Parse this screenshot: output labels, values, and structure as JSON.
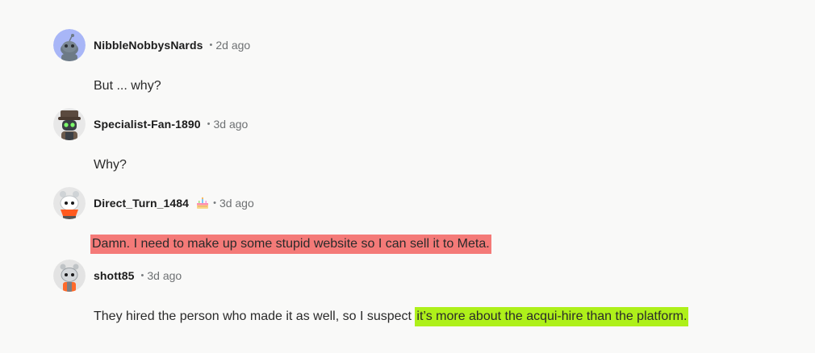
{
  "comments": [
    {
      "username": "NibbleNobbysNards",
      "time": "2d ago",
      "separator": "•",
      "body": "But ... why?",
      "avatar": "default-snoo-blue-avatar"
    },
    {
      "username": "Specialist-Fan-1890",
      "time": "3d ago",
      "separator": "•",
      "body": "Why?",
      "avatar": "snoo-robot-hat-avatar"
    },
    {
      "username": "Direct_Turn_1484",
      "time": "3d ago",
      "separator": "•",
      "flair": "cake-day-icon",
      "body_highlight": "Damn. I need to make up some stupid website so I can sell it to Meta.",
      "highlight_color": "#f47a78",
      "avatar": "snoo-orange-bandana-avatar"
    },
    {
      "username": "shott85",
      "time": "3d ago",
      "separator": "•",
      "body_plain": "They hired the person who made it as well, so I suspect ",
      "body_highlight": "it’s more about the acqui-hire than the platform.",
      "highlight_color": "#aef01a",
      "avatar": "snoo-grey-orange-avatar"
    }
  ]
}
